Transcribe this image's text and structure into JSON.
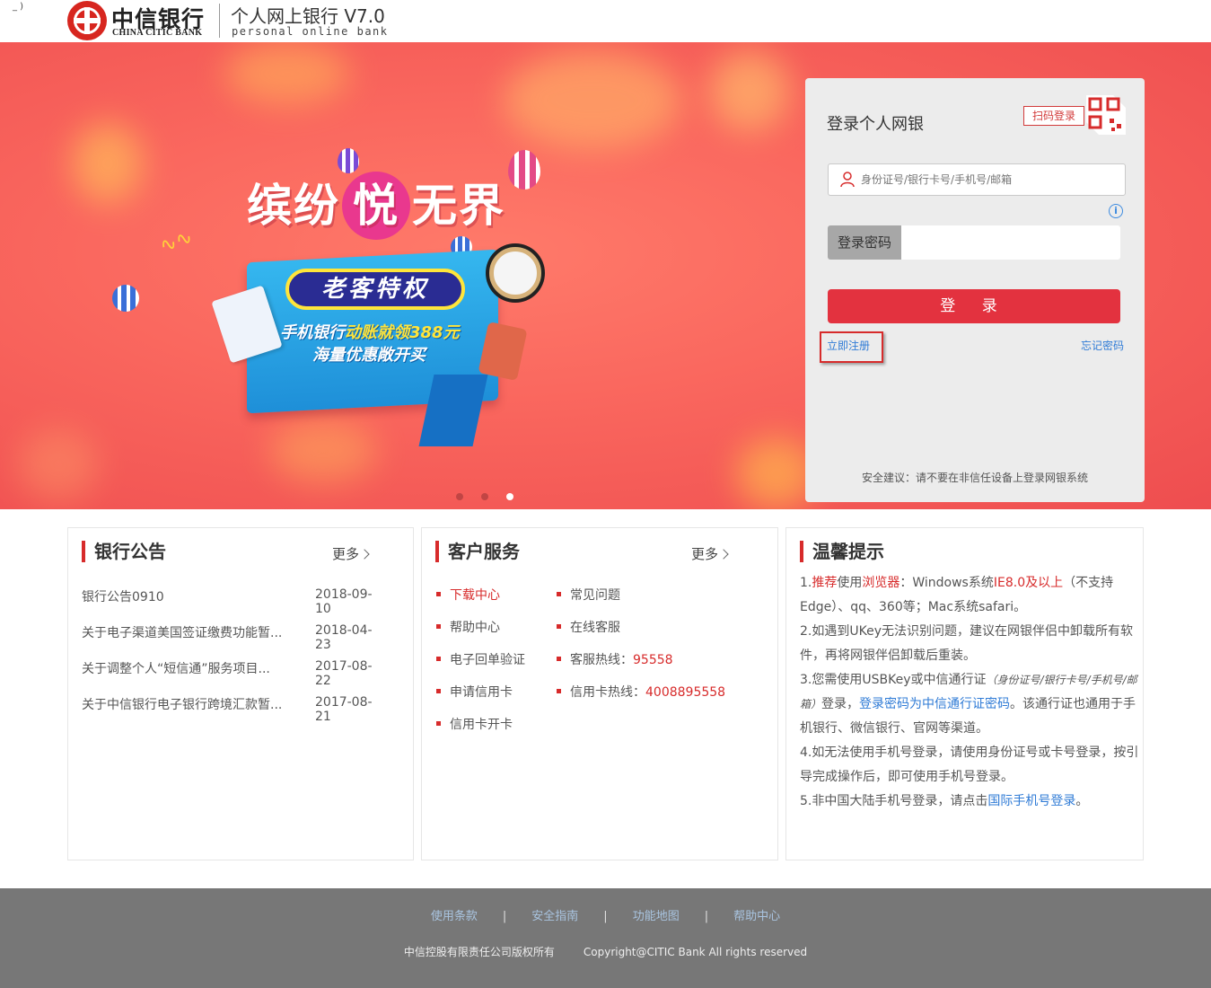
{
  "header": {
    "corner_mark": "_ )",
    "bank_name_cn": "中信银行",
    "bank_name_en": "CHINA CITIC BANK",
    "app_title": "个人网上银行 V7.0",
    "app_subtitle": "personal online bank"
  },
  "banner": {
    "promo_title_left": "缤纷",
    "promo_title_mid": "悦",
    "promo_title_right": "无界",
    "pill_text": "老客特权",
    "line1_a": "手机银行",
    "line1_b": "动账就领388元",
    "line2": "海量优惠敞开买",
    "slides": 3,
    "active_slide": 3
  },
  "login": {
    "title": "登录个人网银",
    "qr_label": "扫码登录",
    "user_placeholder": "身份证号/银行卡号/手机号/邮箱",
    "password_label": "登录密码",
    "login_button": "登 录",
    "register_link": "立即注册",
    "forgot_link": "忘记密码",
    "security_note": "安全建议：请不要在非信任设备上登录网银系统"
  },
  "notices": {
    "title": "银行公告",
    "more": "更多",
    "items": [
      {
        "title": "银行公告0910",
        "date": "2018-09-10"
      },
      {
        "title": "关于电子渠道美国签证缴费功能暂...",
        "date": "2018-04-23"
      },
      {
        "title": "关于调整个人“短信通”服务项目...",
        "date": "2017-08-22"
      },
      {
        "title": "关于中信银行电子银行跨境汇款暂...",
        "date": "2017-08-21"
      }
    ]
  },
  "service": {
    "title": "客户服务",
    "more": "更多",
    "left": [
      "下载中心",
      "帮助中心",
      "电子回单验证",
      "申请信用卡",
      "信用卡开卡"
    ],
    "right_faq": "常见问题",
    "right_online": "在线客服",
    "hotline_label": "客服热线：",
    "hotline_number": "95558",
    "cc_hotline_label": "信用卡热线：",
    "cc_hotline_number": "4008895558"
  },
  "tips": {
    "title": "温馨提示",
    "t1_a": "1.",
    "t1_b": "推荐",
    "t1_c": "使用",
    "t1_d": "浏览器",
    "t1_e": "：Windows系统",
    "t1_f": "IE8.0及以上",
    "t1_g": "（不支持Edge）、qq、360等；Mac系统safari。",
    "t2": "2.如遇到UKey无法识别问题，建议在网银伴侣中卸载所有软件，再将网银伴侣卸载后重装。",
    "t3_a": "3.您需使用USBKey或中信通行证",
    "t3_b": "（身份证号/银行卡号/手机号/邮箱）",
    "t3_c": "登录，",
    "t3_d": "登录密码为中信通行证密码",
    "t3_e": "。该通行证也通用于手机银行、微信银行、官网等渠道。",
    "t4": "4.如无法使用手机号登录，请使用身份证号或卡号登录，按引导完成操作后，即可使用手机号登录。",
    "t5_a": "5.非中国大陆手机号登录，请点击",
    "t5_b": "国际手机号登录",
    "t5_c": "。"
  },
  "footer": {
    "links": [
      "使用条款",
      "安全指南",
      "功能地图",
      "帮助中心"
    ],
    "company": "中信控股有限责任公司版权所有",
    "copyright": "Copyright@CITIC Bank All rights reserved"
  },
  "colors": {
    "brand_red": "#d72b2b",
    "login_button": "#e3323f",
    "link_blue": "#2f7bd6",
    "footer_bg": "#777777"
  }
}
